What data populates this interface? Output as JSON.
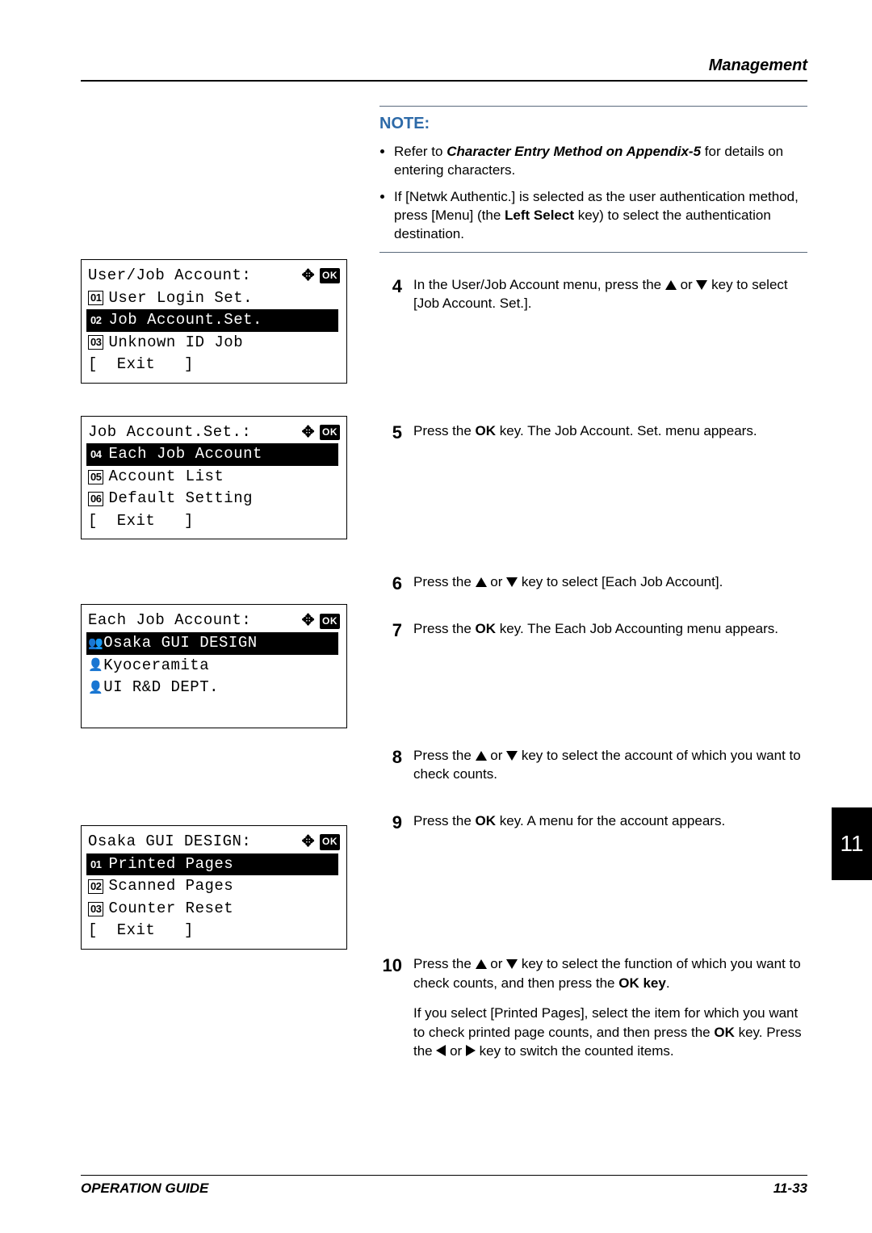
{
  "header": {
    "section": "Management"
  },
  "chapter": "11",
  "note": {
    "title": "NOTE:",
    "bullet1_intro": "Refer to ",
    "bullet1_ref": "Character Entry Method on Appendix-5",
    "bullet1_tail": " for details on entering characters.",
    "bullet2a": "If [Netwk Authentic.] is selected as the user authentication method, press [Menu] (the ",
    "bullet2b": "Left Select",
    "bullet2c": " key) to select the authentication destination."
  },
  "panels": {
    "p1": {
      "title": "User/Job Account:",
      "items": [
        "User Login Set.",
        "Job Account.Set.",
        "Unknown ID Job"
      ],
      "nums": [
        "01",
        "02",
        "03"
      ],
      "selected": 1,
      "exit": "[  Exit   ]"
    },
    "p2": {
      "title": "Job Account.Set.:",
      "items": [
        "Each Job Account",
        "Account List",
        "Default Setting"
      ],
      "nums": [
        "04",
        "05",
        "06"
      ],
      "selected": 0,
      "exit": "[  Exit   ]"
    },
    "p3": {
      "title": "Each Job Account:",
      "items": [
        "Osaka GUI DESIGN",
        "Kyoceramita",
        "UI R&D DEPT."
      ],
      "selected": 0
    },
    "p4": {
      "title": "Osaka GUI DESIGN:",
      "items": [
        "Printed Pages",
        "Scanned Pages",
        "Counter Reset"
      ],
      "nums": [
        "01",
        "02",
        "03"
      ],
      "selected": 0,
      "exit": "[  Exit   ]"
    }
  },
  "steps": {
    "s4": "In the User/Job Account menu, press the △ or ▽ key to select [Job Account. Set.].",
    "s5a": "Press the ",
    "s5b": "OK",
    "s5c": " key. The Job Account. Set. menu appears.",
    "s6": "Press the △ or ▽ key to select [Each Job Account].",
    "s7a": "Press the ",
    "s7b": "OK",
    "s7c": " key. The Each Job Accounting menu appears.",
    "s8": "Press the △ or ▽ key to select the account of which you want to check counts.",
    "s9a": "Press the ",
    "s9b": "OK",
    "s9c": " key. A menu for the account appears.",
    "s10a": "Press the △ or ▽ key to select the function of which you want to check counts, and then press the ",
    "s10b": "OK key",
    "s10c": ".",
    "s10p2a": "If you select [Printed Pages], select the item for which you want to check printed page counts, and then press the ",
    "s10p2b": "OK",
    "s10p2c": " key. Press the ◁ or ▷ key to switch the counted items."
  },
  "footer": {
    "left": "OPERATION GUIDE",
    "page": "11-33"
  }
}
